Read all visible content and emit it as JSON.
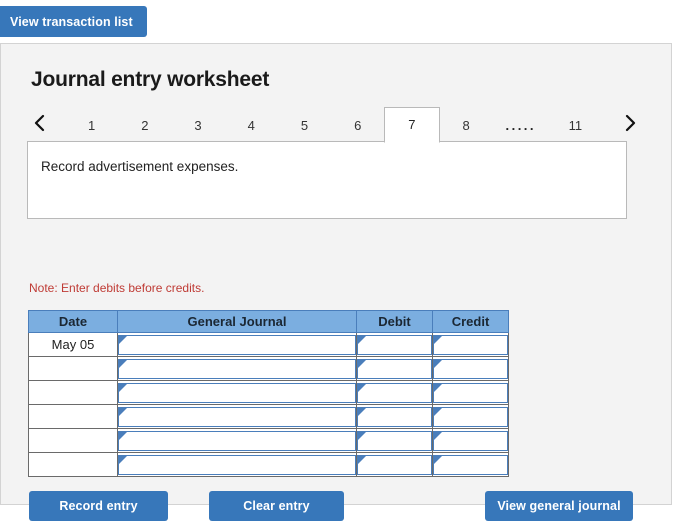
{
  "top": {
    "view_transaction_list_label": "View transaction list"
  },
  "panel": {
    "title": "Journal entry worksheet",
    "tabs": {
      "prev_icon": "chevron-left-icon",
      "next_icon": "chevron-right-icon",
      "items": [
        {
          "label": "1",
          "active": false
        },
        {
          "label": "2",
          "active": false
        },
        {
          "label": "3",
          "active": false
        },
        {
          "label": "4",
          "active": false
        },
        {
          "label": "5",
          "active": false
        },
        {
          "label": "6",
          "active": false
        },
        {
          "label": "7",
          "active": true
        },
        {
          "label": "8",
          "active": false
        },
        {
          "label": ".....",
          "active": false,
          "ellipsis": true
        },
        {
          "label": "11",
          "active": false
        }
      ]
    },
    "description": "Record advertisement expenses.",
    "note": "Note: Enter debits before credits.",
    "table": {
      "headers": [
        "Date",
        "General Journal",
        "Debit",
        "Credit"
      ],
      "rows": [
        {
          "date": "May 05",
          "general_journal": "",
          "debit": "",
          "credit": ""
        },
        {
          "date": "",
          "general_journal": "",
          "debit": "",
          "credit": ""
        },
        {
          "date": "",
          "general_journal": "",
          "debit": "",
          "credit": ""
        },
        {
          "date": "",
          "general_journal": "",
          "debit": "",
          "credit": ""
        },
        {
          "date": "",
          "general_journal": "",
          "debit": "",
          "credit": ""
        },
        {
          "date": "",
          "general_journal": "",
          "debit": "",
          "credit": ""
        }
      ]
    },
    "actions": {
      "record_entry_label": "Record entry",
      "clear_entry_label": "Clear entry",
      "view_general_journal_label": "View general journal"
    }
  },
  "colors": {
    "button_blue": "#3777ba",
    "header_blue": "#7baee0",
    "header_border_blue": "#4a7ebb",
    "note_red": "#bf3b35",
    "panel_bg": "#f3f3f3"
  }
}
